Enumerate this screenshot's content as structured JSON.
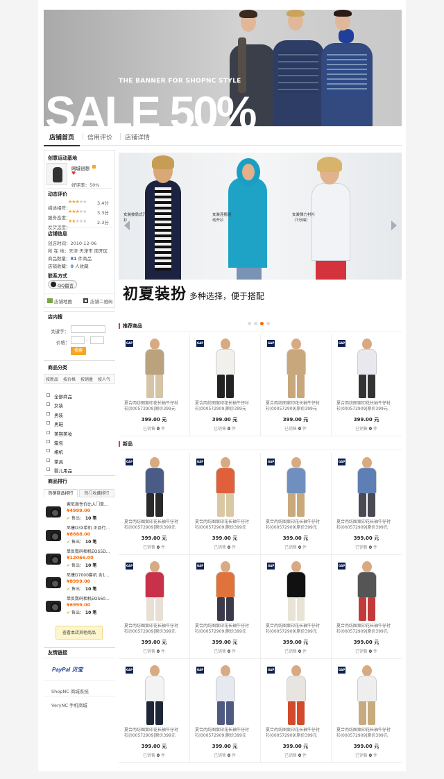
{
  "banner": {
    "tagline": "THE BANNER FOR SHOPNC STYLE",
    "headline": "SALE 50%"
  },
  "tabs": [
    {
      "label": "店铺首页",
      "active": true
    },
    {
      "label": "信用评价"
    },
    {
      "label": "店铺详情"
    }
  ],
  "store": {
    "header": "创意运动基地",
    "name": "网城创想",
    "rating": "好评率：50%",
    "dynamic_title": "动态评价",
    "scores": [
      {
        "label": "描述相符：",
        "value": "3.4分",
        "stars": 3.4
      },
      {
        "label": "服务态度：",
        "value": "3.3分",
        "stars": 3.3
      },
      {
        "label": "发货速度：",
        "value": "2.3分",
        "stars": 2.3
      }
    ],
    "info_title": "店铺信息",
    "info": [
      {
        "label": "创店时间：",
        "value": "2010-12-06"
      },
      {
        "label": "所 在 地：",
        "value": "天津 天津市 南开区"
      },
      {
        "label": "商品数量：",
        "value": "81",
        "suffix": "件商品"
      },
      {
        "label": "店铺收藏：",
        "value": "0",
        "suffix": "人收藏"
      }
    ],
    "contact_title": "联系方式",
    "qq_label": "QQ留言",
    "map_label": "店铺地图",
    "qr_label": "店铺二维码"
  },
  "search": {
    "title": "店内搜",
    "keyword_label": "关键字：",
    "price_label": "价格：",
    "price_sep": "-",
    "button": "搜索"
  },
  "categories": {
    "title": "商品分类",
    "sort": [
      "按新品",
      "按价格",
      "按销量",
      "按人气"
    ],
    "items": [
      "全部商品",
      "女装",
      "男装",
      "男鞋",
      "美容美妆",
      "箱包",
      "相机",
      "茶具",
      "婴儿用品"
    ]
  },
  "ranking": {
    "title": "商品排行",
    "tabs": [
      "热销商品排行",
      "热门收藏排行"
    ],
    "items": [
      {
        "name": "索尼高性价比入门单...",
        "price": "¥4999.00",
        "sold": "售出：",
        "count": "10 笔"
      },
      {
        "name": "尼康D3X单机 正品行...",
        "price": "¥8688.00",
        "sold": "售出：",
        "count": "10 笔"
      },
      {
        "name": "单反数码相机EOS5D...",
        "price": "¥12066.00",
        "sold": "售出：",
        "count": "10 笔"
      },
      {
        "name": "尼康D7000套机 含1...",
        "price": "¥8999.00",
        "sold": "售出：",
        "count": "10 笔"
      },
      {
        "name": "单反数码相机EOS60...",
        "price": "¥6999.00",
        "sold": "售出：",
        "count": "10 笔"
      }
    ],
    "more": "查看本店其他商品"
  },
  "links": {
    "title": "友情链接",
    "logo": "PayPal 贝宝",
    "items": [
      "ShopNC 商城系统",
      "VeryNC 手机商城"
    ]
  },
  "hero": {
    "captions": [
      "女装披肩式开衫",
      "女装连帽运动开衫",
      "女装弹力衬衫（7分袖）"
    ],
    "headline": "初夏装扮",
    "subline": "多种选择，便于搭配"
  },
  "recommend": {
    "title": "推荐商品"
  },
  "new": {
    "title": "新品"
  },
  "product": {
    "brand": "GAP",
    "name": "夏合丙纺图案印花长袖牛仔衬衫|000572909|原价399元",
    "price": "399.00 元",
    "sold_label": "已销售",
    "sold_count": "0",
    "sold_unit": "件"
  }
}
